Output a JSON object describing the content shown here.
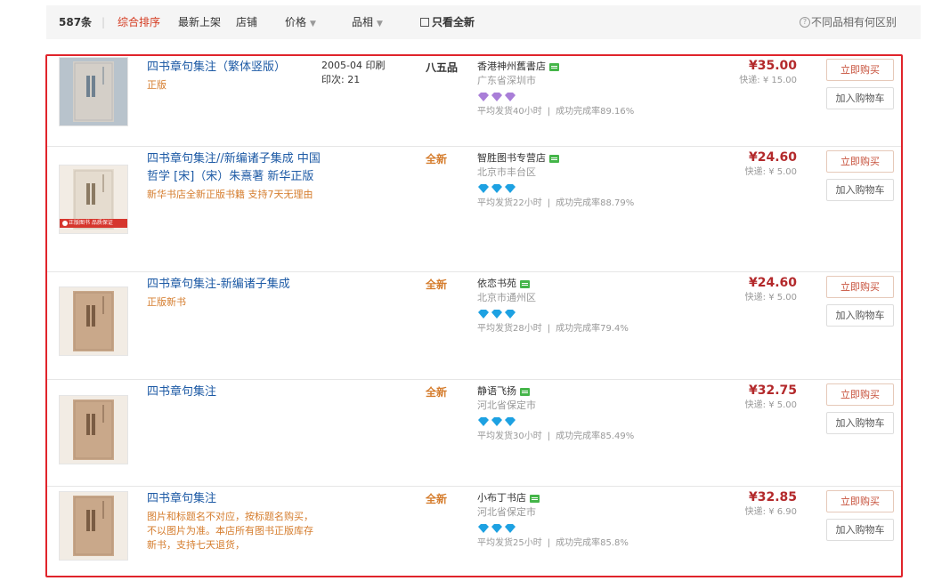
{
  "sortbar": {
    "count": "587条",
    "divider": "|",
    "default_sort": "综合排序",
    "newest": "最新上架",
    "shop": "店铺",
    "price": "价格",
    "condition": "品相",
    "caret": "▼",
    "only_new": "只看全新",
    "help": "不同品相有何区别",
    "help_icon": "?"
  },
  "buttons": {
    "buy": "立即购买",
    "cart": "加入购物车"
  },
  "colors": {
    "accent": "#d4391f",
    "link": "#1d5aa5",
    "price": "#b3292b",
    "highlight_border": "#e0242b",
    "rating_purple": "#a97ed8",
    "rating_blue": "#1da1e2"
  },
  "results": [
    {
      "title": "四书章句集注（繁体竖版）",
      "sub": "正版",
      "date_line1": "2005-04 印刷",
      "date_line2": "印次: 21",
      "condition": "八五品",
      "condition_color": "#333333",
      "shop": "香港神州舊書店",
      "location": "广东省深圳市",
      "rating_color": "purple",
      "stats_prefix": "平均发货40小时",
      "stats_sep": "|",
      "stats_suffix": "成功完成率89.16%",
      "price": "¥35.00",
      "ship": "快递: ¥ 15.00",
      "cover": "gray-book-icon"
    },
    {
      "title": "四书章句集注//新编诸子集成 中国哲学 [宋]（宋）朱熹著 新华正版",
      "sub": "新华书店全新正版书籍 支持7天无理由",
      "condition": "全新",
      "condition_color": "#d57d2e",
      "shop": "智胜图书专营店",
      "location": "北京市丰台区",
      "rating_color": "blue",
      "stats_prefix": "平均发货22小时",
      "stats_sep": "|",
      "stats_suffix": "成功完成率88.79%",
      "price": "¥24.60",
      "ship": "快递: ¥ 5.00",
      "cover": "light-book-icon",
      "banner": "正版图书 品质保证"
    },
    {
      "title": "四书章句集注-新编诸子集成",
      "sub": "正版新书",
      "condition": "全新",
      "condition_color": "#d57d2e",
      "shop": "依恋书苑",
      "location": "北京市通州区",
      "rating_color": "blue",
      "stats_prefix": "平均发货28小时",
      "stats_sep": "|",
      "stats_suffix": "成功完成率79.4%",
      "price": "¥24.60",
      "ship": "快递: ¥ 5.00",
      "cover": "tan-book-icon"
    },
    {
      "title": "四书章句集注",
      "sub": "",
      "condition": "全新",
      "condition_color": "#d57d2e",
      "shop": "静语飞扬",
      "location": "河北省保定市",
      "rating_color": "blue",
      "stats_prefix": "平均发货30小时",
      "stats_sep": "|",
      "stats_suffix": "成功完成率85.49%",
      "price": "¥32.75",
      "ship": "快递: ¥ 5.00",
      "cover": "tan-book-icon"
    },
    {
      "title": "四书章句集注",
      "sub": "图片和标题名不对应，按标题名购买，不以图片为准。本店所有图书正版库存新书，支持七天退货，",
      "condition": "全新",
      "condition_color": "#d57d2e",
      "shop": "小布丁书店",
      "location": "河北省保定市",
      "rating_color": "blue",
      "stats_prefix": "平均发货25小时",
      "stats_sep": "|",
      "stats_suffix": "成功完成率85.8%",
      "price": "¥32.85",
      "ship": "快递: ¥ 6.90",
      "cover": "tan-book-icon"
    }
  ]
}
